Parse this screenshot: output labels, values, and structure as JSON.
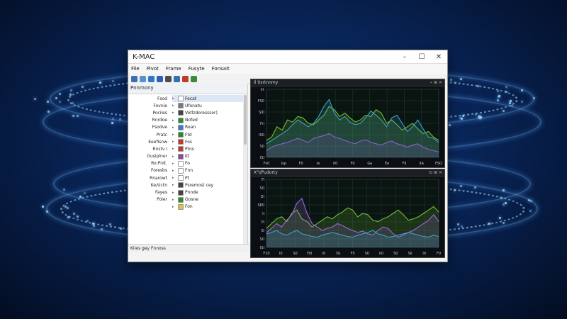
{
  "window": {
    "title": "K-MAC",
    "controls": [
      "–",
      "☐",
      "✕"
    ]
  },
  "menu": [
    "File",
    "Pivot",
    "Frame",
    "Fusyte",
    "Fonsait"
  ],
  "toolbar": [
    {
      "icon": "arrow-icon",
      "color": "#3a6fb0"
    },
    {
      "icon": "pointer-icon",
      "color": "#5a8fd0"
    },
    {
      "icon": "wave-icon",
      "color": "#2f77c9"
    },
    {
      "icon": "cloud-icon",
      "color": "#2a62b8"
    },
    {
      "icon": "search-icon",
      "color": "#4d4d4d"
    },
    {
      "icon": "link-icon",
      "color": "#3a6fb0"
    },
    {
      "icon": "edit-icon",
      "color": "#c23a2a"
    },
    {
      "icon": "chart-icon",
      "color": "#3a8a3a"
    }
  ],
  "left_pane": {
    "header": "Pnnmony",
    "col1": [
      "Fsod",
      "Fovnie",
      "Pociles",
      "Rnrdoe",
      "Fsodve",
      "Pratc",
      "Eeefisnw",
      "Rnstv i",
      "Gusiplner",
      "Ro:Pnlt.",
      "Foresbs",
      "Rnarowt",
      "Ke/Uctn",
      "Fayes",
      "Poler"
    ],
    "col2": [
      {
        "label": "Fecat",
        "color": "#ffffff",
        "selected": true
      },
      {
        "label": "Ufonatu",
        "color": "#7a7a7a"
      },
      {
        "label": "Votlzdoresssor)",
        "color": "#444444"
      },
      {
        "label": "Nofed",
        "color": "#2c8a2c"
      },
      {
        "label": "Roan",
        "color": "#3c7ad0"
      },
      {
        "label": "Ftd",
        "color": "#2c8a2c"
      },
      {
        "label": "Fos",
        "color": "#c23a2a"
      },
      {
        "label": "Ptns",
        "color": "#c23a2a"
      },
      {
        "label": "Kt",
        "color": "#8a4a9a"
      },
      {
        "label": "Fo",
        "color": "#ffffff"
      },
      {
        "label": "Fnn",
        "color": "#ffffff"
      },
      {
        "label": "Pt",
        "color": "#ffffff"
      },
      {
        "label": "Psremost cey",
        "color": "#444444"
      },
      {
        "label": "Pnnde",
        "color": "#444444"
      },
      {
        "label": "Gosne",
        "color": "#2c8a2c"
      },
      {
        "label": "Fon",
        "color": "#e0c040"
      }
    ],
    "status": "Kiies gey Fnnoss"
  },
  "charts": [
    {
      "title": "Ii tisrtnnmy",
      "y_ticks": [
        "Irt",
        "FS0",
        "SI0",
        "Fri",
        "IS0",
        "S0",
        "ISI"
      ],
      "x_ticks": [
        "Fs0",
        "Isp",
        "F0",
        "Ie",
        "II0",
        "F0",
        "Ga",
        "Ee",
        "FII",
        "IIA",
        "FSO"
      ],
      "controls": [
        "⌁",
        "⊞",
        "✕"
      ]
    },
    {
      "title": "X\"I/Pudorty",
      "y_ticks": [
        "Fi",
        "S0",
        "Di",
        "SE0",
        "Ii",
        "Pi",
        "I0",
        "S0",
        "ISI"
      ],
      "x_ticks": [
        "F10",
        "I0",
        "S0",
        "Fi0",
        "I0",
        "ISI",
        "F5",
        "S0",
        "II0",
        "S0",
        "SII",
        "I0",
        "F0"
      ],
      "controls": [
        "⊡",
        "⊞",
        "✕"
      ]
    }
  ],
  "chart_data": [
    {
      "type": "area",
      "title": "Ii tisrtnnmy",
      "ylim": [
        0,
        100
      ],
      "series": [
        {
          "color": "#6fbf3a",
          "values": [
            25,
            30,
            45,
            40,
            55,
            52,
            60,
            58,
            50,
            48,
            55,
            62,
            75,
            70,
            60,
            65,
            58,
            52,
            55,
            62,
            60,
            70,
            65,
            50,
            55,
            48,
            40,
            45,
            50,
            42,
            35,
            38,
            30,
            25
          ]
        },
        {
          "color": "#3fa0c8",
          "values": [
            20,
            25,
            30,
            35,
            40,
            48,
            55,
            50,
            45,
            50,
            60,
            75,
            85,
            65,
            55,
            60,
            52,
            48,
            50,
            58,
            68,
            62,
            55,
            45,
            58,
            62,
            50,
            38,
            45,
            55,
            42,
            30,
            28,
            22
          ]
        },
        {
          "color": "#8a5fd0",
          "values": [
            10,
            15,
            18,
            20,
            22,
            25,
            28,
            25,
            22,
            28,
            30,
            32,
            35,
            30,
            28,
            25,
            22,
            20,
            24,
            26,
            22,
            20,
            18,
            22,
            24,
            20,
            18,
            15,
            18,
            20,
            15,
            12,
            10,
            8
          ]
        }
      ]
    },
    {
      "type": "area",
      "title": "X\"I/Pudorty",
      "ylim": [
        0,
        100
      ],
      "series": [
        {
          "color": "#6fbf3a",
          "values": [
            28,
            35,
            42,
            45,
            38,
            50,
            55,
            42,
            38,
            30,
            35,
            40,
            45,
            42,
            48,
            52,
            58,
            55,
            45,
            50,
            48,
            40,
            38,
            42,
            45,
            50,
            55,
            48,
            40,
            42,
            45,
            50,
            55,
            60,
            52
          ]
        },
        {
          "color": "#a066e0",
          "values": [
            22,
            28,
            35,
            30,
            40,
            48,
            65,
            72,
            50,
            35,
            30,
            25,
            28,
            30,
            35,
            32,
            28,
            25,
            22,
            24,
            20,
            18,
            25,
            30,
            28,
            20,
            15,
            18,
            22,
            25,
            30,
            35,
            40,
            48,
            38
          ]
        },
        {
          "color": "#3fa0c8",
          "values": [
            20,
            22,
            25,
            20,
            18,
            22,
            25,
            20,
            18,
            16,
            15,
            18,
            20,
            22,
            20,
            18,
            16,
            15,
            18,
            20,
            22,
            25,
            20,
            18,
            15,
            16,
            18,
            20,
            22,
            20,
            18,
            16,
            15,
            18,
            16
          ]
        }
      ]
    }
  ]
}
